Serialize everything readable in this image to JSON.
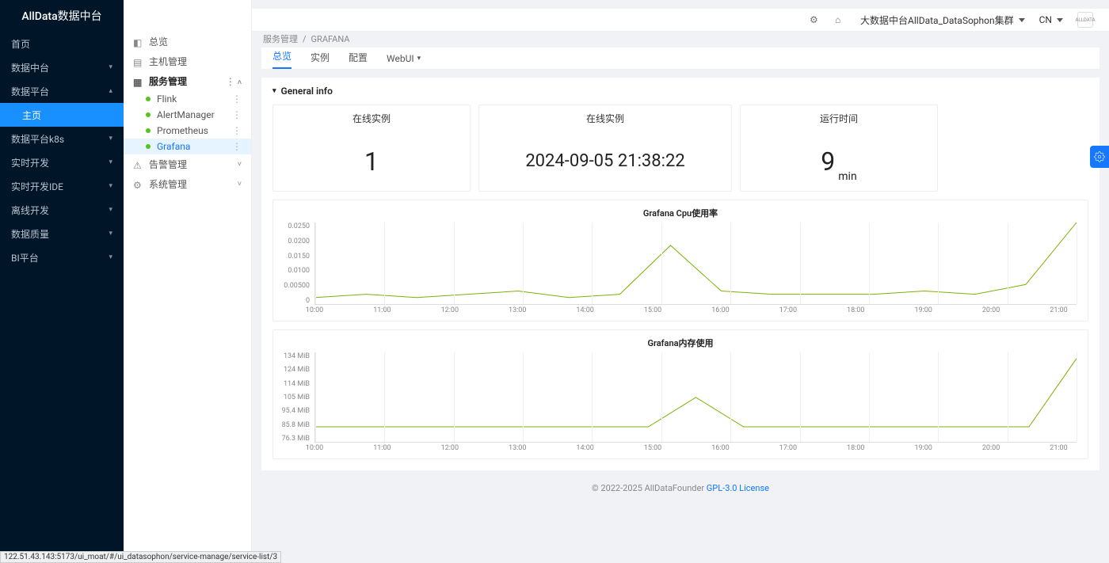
{
  "brand": "AllData数据中台",
  "left_menu": {
    "home": "首页",
    "data_center": "数据中台",
    "data_platform": "数据平台",
    "data_platform_home": "主页",
    "data_platform_k8s": "数据平台k8s",
    "realtime_dev": "实时开发",
    "realtime_ide": "实时开发IDE",
    "offline_dev": "离线开发",
    "data_quality": "数据质量",
    "bi_platform": "BI平台"
  },
  "mid_menu": {
    "overview": "总览",
    "host_mgmt": "主机管理",
    "service_mgmt": "服务管理",
    "items": [
      "Flink",
      "AlertManager",
      "Prometheus",
      "Grafana"
    ],
    "alert_mgmt": "告警管理",
    "system_mgmt": "系统管理"
  },
  "topnav": {
    "cluster": "大数据中台AllData_DataSophon集群",
    "lang": "CN",
    "avatar": "ALLDATA"
  },
  "breadcrumb": {
    "a": "服务管理",
    "sep": "/",
    "b": "GRAFANA"
  },
  "tabs": {
    "overview": "总览",
    "instance": "实例",
    "config": "配置",
    "webui": "WebUI"
  },
  "section": {
    "title": "General info",
    "cards": {
      "online_instance": {
        "title": "在线实例",
        "value": "1"
      },
      "online_instance2": {
        "title": "在线实例",
        "value": "2024-09-05 21:38:22"
      },
      "uptime": {
        "title": "运行时间",
        "value": "9",
        "unit": "min"
      }
    }
  },
  "chart_data": [
    {
      "type": "line",
      "title": "Grafana Cpu使用率",
      "x": [
        "10:00",
        "11:00",
        "12:00",
        "13:00",
        "14:00",
        "15:00",
        "16:00",
        "17:00",
        "18:00",
        "19:00",
        "20:00",
        "21:00"
      ],
      "y_ticks": [
        "0.0250",
        "0.0200",
        "0.0150",
        "0.0100",
        "0.00500",
        "0"
      ],
      "ylim": [
        0,
        0.025
      ],
      "series": [
        {
          "name": "cpu",
          "values": [
            0.002,
            0.003,
            0.002,
            0.003,
            0.004,
            0.002,
            0.003,
            0.018,
            0.004,
            0.003,
            0.003,
            0.003,
            0.004,
            0.003,
            0.006,
            0.025
          ]
        }
      ]
    },
    {
      "type": "line",
      "title": "Grafana内存使用",
      "x": [
        "10:00",
        "11:00",
        "12:00",
        "13:00",
        "14:00",
        "15:00",
        "16:00",
        "17:00",
        "18:00",
        "19:00",
        "20:00",
        "21:00"
      ],
      "y_ticks": [
        "134 MiB",
        "124 MiB",
        "114 MiB",
        "105 MiB",
        "95.4 MiB",
        "85.8 MiB",
        "76.3 MiB"
      ],
      "ylim": [
        76.3,
        134
      ],
      "series": [
        {
          "name": "mem",
          "values": [
            86,
            86,
            86,
            86,
            86,
            86,
            86,
            86,
            105,
            86,
            86,
            86,
            86,
            86,
            86,
            86,
            130
          ]
        }
      ]
    }
  ],
  "footer": {
    "copyright": "© 2022-2025 AllDataFounder ",
    "license": "GPL-3.0 License"
  },
  "status_url": "122.51.43.143:5173/ui_moat/#/ui_datasophon/service-manage/service-list/3"
}
